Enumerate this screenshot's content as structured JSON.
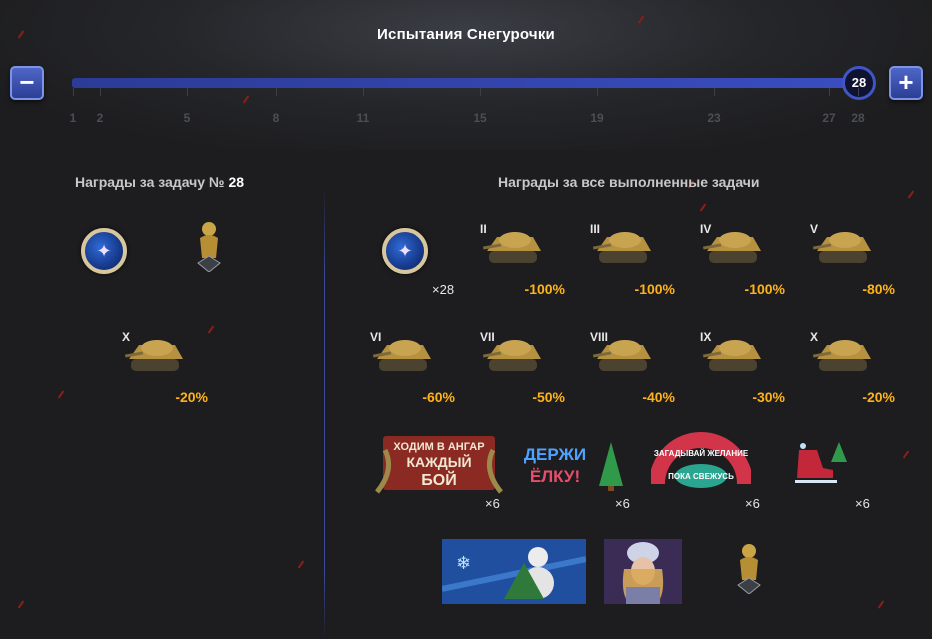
{
  "header": {
    "title": "Испытания Снегурочки",
    "minus_label": "−",
    "plus_label": "+",
    "current_value": "28",
    "progress_fraction": 1.0
  },
  "ticks": [
    "1",
    "2",
    "5",
    "8",
    "11",
    "15",
    "19",
    "23",
    "27",
    "28"
  ],
  "left_panel": {
    "heading_prefix": "Награды за задачу №",
    "heading_number": "28",
    "tank": {
      "tier": "X",
      "discount": "-20%"
    }
  },
  "right_panel": {
    "heading": "Награды за все выполненные задачи",
    "medal_count": "×28",
    "tanks": [
      {
        "tier": "II",
        "discount": "-100%"
      },
      {
        "tier": "III",
        "discount": "-100%"
      },
      {
        "tier": "IV",
        "discount": "-100%"
      },
      {
        "tier": "V",
        "discount": "-80%"
      },
      {
        "tier": "VI",
        "discount": "-60%"
      },
      {
        "tier": "VII",
        "discount": "-50%"
      },
      {
        "tier": "VIII",
        "discount": "-40%"
      },
      {
        "tier": "IX",
        "discount": "-30%"
      },
      {
        "tier": "X",
        "discount": "-20%"
      }
    ],
    "decals": [
      {
        "lines": [
          "ХОДИМ В АНГАР",
          "КАЖДЫЙ",
          "БОЙ"
        ],
        "count": "×6"
      },
      {
        "lines": [
          "ДЕРЖИ",
          "ЁЛКУ!"
        ],
        "count": "×6"
      },
      {
        "lines": [
          "ЗАГАДЫВАЙ ЖЕЛАНИЕ",
          "ПОКА СВЕЖУСЬ"
        ],
        "count": "×6"
      },
      {
        "lines": [],
        "count": "×6"
      }
    ]
  },
  "colors": {
    "accent_blue": "#3a4dc0",
    "discount_orange": "#ffb31a",
    "background": "#1d1d1f"
  },
  "icons": {
    "medal": "medal-icon",
    "figurine": "snow-maiden-figurine-icon",
    "tank": "tank-icon"
  }
}
